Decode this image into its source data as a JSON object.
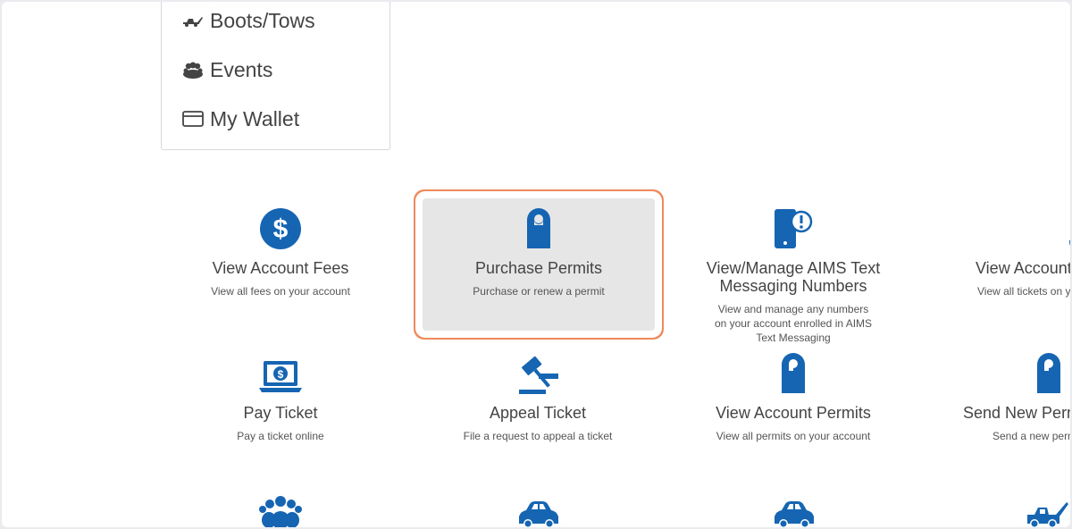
{
  "menu": {
    "items": [
      {
        "label": "Boots/Tows",
        "icon": "tow-truck-icon"
      },
      {
        "label": "Events",
        "icon": "crowd-icon"
      },
      {
        "label": "My Wallet",
        "icon": "credit-card-icon"
      }
    ]
  },
  "colors": {
    "icon_blue": "#1565b3",
    "highlight_border": "#f08a5d",
    "selected_bg": "#e6e6e6"
  },
  "tiles": [
    {
      "title": "View Account Fees",
      "desc": "View all fees on your account",
      "icon": "dollar-circle-icon"
    },
    {
      "title": "Purchase Permits",
      "desc": "Purchase or renew a permit",
      "icon": "door-hanger-permit-icon",
      "selected": true
    },
    {
      "title": "View/Manage AIMS Text Messaging Numbers",
      "desc": "View and manage any numbers on your account enrolled in AIMS Text Messaging",
      "icon": "phone-alert-icon"
    },
    {
      "title": "View Account",
      "desc": "View all tickets on yo",
      "icon": "receipt-icon"
    },
    {
      "title": "Pay Ticket",
      "desc": "Pay a ticket online",
      "icon": "laptop-dollar-icon"
    },
    {
      "title": "Appeal Ticket",
      "desc": "File a request to appeal a ticket",
      "icon": "gavel-icon"
    },
    {
      "title": "View Account Permits",
      "desc": "View all permits on your account",
      "icon": "door-hanger-permit-icon"
    },
    {
      "title": "Send New Perm",
      "desc": "Send a new perm",
      "icon": "door-hanger-permit-icon"
    },
    {
      "title": "",
      "desc": "",
      "icon": "users-group-icon"
    },
    {
      "title": "",
      "desc": "",
      "icon": "car-icon"
    },
    {
      "title": "",
      "desc": "",
      "icon": "car-icon"
    },
    {
      "title": "",
      "desc": "",
      "icon": "tow-truck-icon"
    }
  ]
}
